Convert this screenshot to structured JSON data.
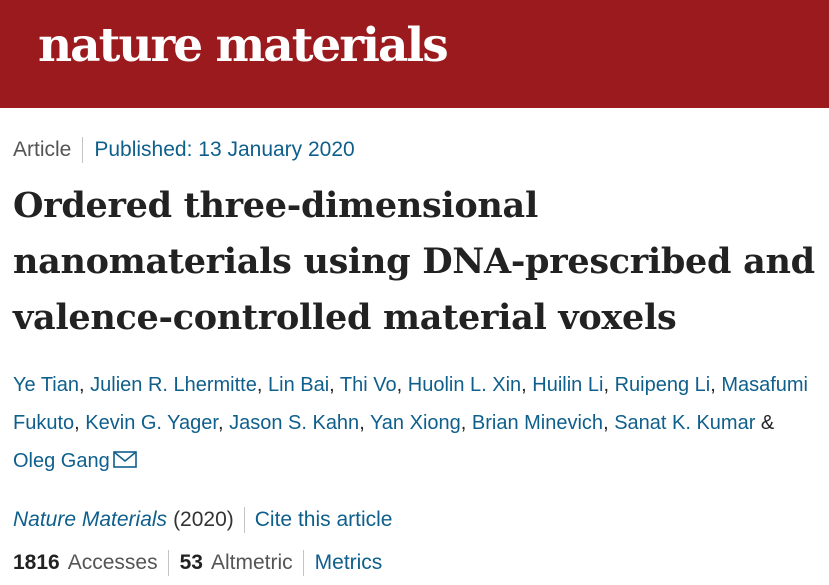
{
  "header": {
    "logo_text": "nature materials",
    "bg_color": "#9b1a1e"
  },
  "article": {
    "type": "Article",
    "published": "Published: 13 January 2020",
    "title": "Ordered three-dimensional nanomaterials using DNA-prescribed and valence-controlled material voxels",
    "authors": [
      "Ye Tian",
      "Julien R. Lhermitte",
      "Lin Bai",
      "Thi Vo",
      "Huolin L. Xin",
      "Huilin Li",
      "Ruipeng Li",
      "Masafumi Fukuto",
      "Kevin G. Yager",
      "Jason S. Kahn",
      "Yan Xiong",
      "Brian Minevich",
      "Sanat K. Kumar",
      "Oleg Gang"
    ],
    "author_separator": ", ",
    "author_last_joiner": " & ",
    "corresponding_icon": "envelope-icon"
  },
  "citation": {
    "journal": "Nature Materials",
    "year": "(2020)",
    "cite_link": "Cite this article"
  },
  "metrics": {
    "accesses_count": "1816",
    "accesses_label": "Accesses",
    "altmetric_count": "53",
    "altmetric_label": "Altmetric",
    "metrics_link": "Metrics"
  },
  "colors": {
    "link": "#0f5f8c",
    "text": "#222222"
  }
}
